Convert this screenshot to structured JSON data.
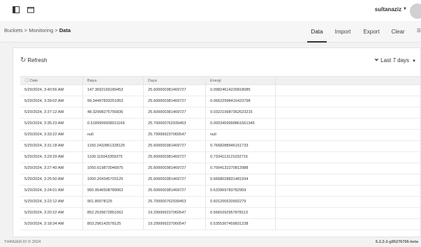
{
  "topbar": {
    "icons": [
      "sidebar-toggle-icon",
      "window-icon"
    ],
    "user": "sultanaziz"
  },
  "breadcrumb": {
    "items": [
      "Buckets",
      "Monitoring",
      "Data"
    ],
    "separator": ">"
  },
  "tabs": [
    {
      "label": "Data",
      "active": true
    },
    {
      "label": "Import",
      "active": false
    },
    {
      "label": "Export",
      "active": false
    },
    {
      "label": "Clear",
      "active": false
    }
  ],
  "toolbar": {
    "refresh_label": "Refresh",
    "range_label": "Last 7 days"
  },
  "table": {
    "headers": [
      "Date",
      "Biaya",
      "Daya",
      "Energi"
    ],
    "rows": [
      [
        "5/20/2024, 3:40:56 AM",
        "147.3692169189453",
        "25.600000381469727",
        "0.09824614226818085"
      ],
      [
        "5/20/2024, 3:39:02 AM",
        "99.34497833251953",
        "25.600000381469727",
        "0.06622998416423798"
      ],
      [
        "5/20/2024, 3:37:12 AM",
        "48.32998275756836",
        "25.600000381469727",
        "0.032219987362623215"
      ],
      [
        "5/20/2024, 3:35:23 AM",
        "0.5189999938011169",
        "25.700000762939453",
        "0.0003459999861661345"
      ],
      [
        "5/20/2024, 3:33:22 AM",
        "null",
        "25.799999237060547",
        "null"
      ],
      [
        "5/20/2024, 3:31:18 AM",
        "1150.2432861328125",
        "25.600000381469727",
        "0.7668288946151733"
      ],
      [
        "5/20/2024, 3:29:29 AM",
        "1100.116943359375",
        "25.600000381469727",
        "0.7334113121032715"
      ],
      [
        "5/20/2024, 3:27:40 AM",
        "1050.619873046875",
        "25.600000381469727",
        "0.7004132270812988"
      ],
      [
        "5/20/2024, 3:25:50 AM",
        "1000.204345703125",
        "25.600000381469727",
        "0.6668028831481934"
      ],
      [
        "5/20/2024, 3:24:01 AM",
        "950.9546508789062",
        "25.600000381469727",
        "0.633969783782959"
      ],
      [
        "5/20/2024, 3:22:12 AM",
        "901.80078125",
        "25.700000762939453",
        "0.601200520992279"
      ],
      [
        "5/20/2024, 3:20:22 AM",
        "852.2539672851562",
        "19.299999237060547",
        "0.5681692957878113"
      ],
      [
        "5/20/2024, 3:18:34 AM",
        "803.296142578125",
        "19.299999237060547",
        "0.5355307459831238"
      ]
    ]
  },
  "footer": {
    "copyright": "THINGER.IO © 2024",
    "version": "6.2.2-2-g95276706-beta"
  }
}
